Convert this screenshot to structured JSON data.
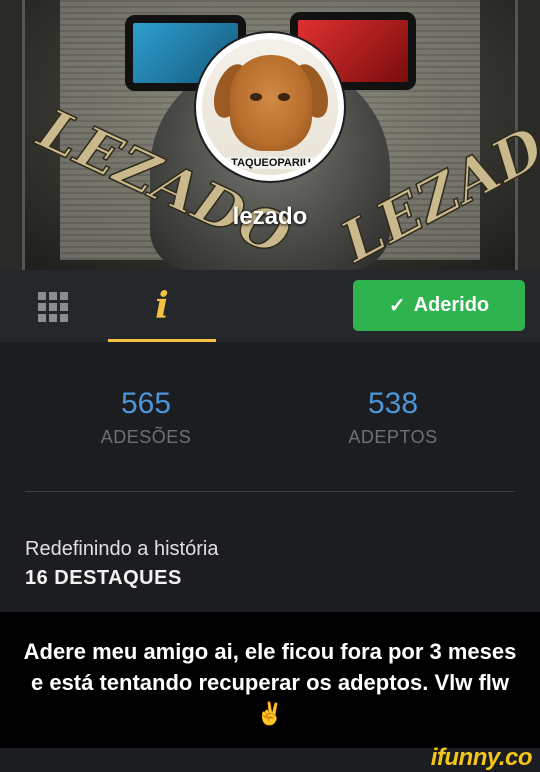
{
  "profile": {
    "cover_text": "LEZADO",
    "avatar_caption": "TAQUEOPARIU",
    "username": "lezado"
  },
  "tabs": {
    "grid_icon": "grid-icon",
    "info_icon": "info-icon",
    "info_glyph": "i",
    "active_tab": "info",
    "accent_color": "#f3c042"
  },
  "join_button": {
    "check": "✓",
    "label": "Aderido",
    "color": "#2fb34f"
  },
  "stats": [
    {
      "value": "565",
      "label": "ADESÕES"
    },
    {
      "value": "538",
      "label": "ADEPTOS"
    }
  ],
  "bio": "Redefinindo a história",
  "highlights": "16 DESTAQUES",
  "caption": "Adere meu amigo ai, ele ficou fora por 3 meses e está tentando recuperar os adeptos. Vlw flw ✌",
  "watermark": "ifunny.co"
}
